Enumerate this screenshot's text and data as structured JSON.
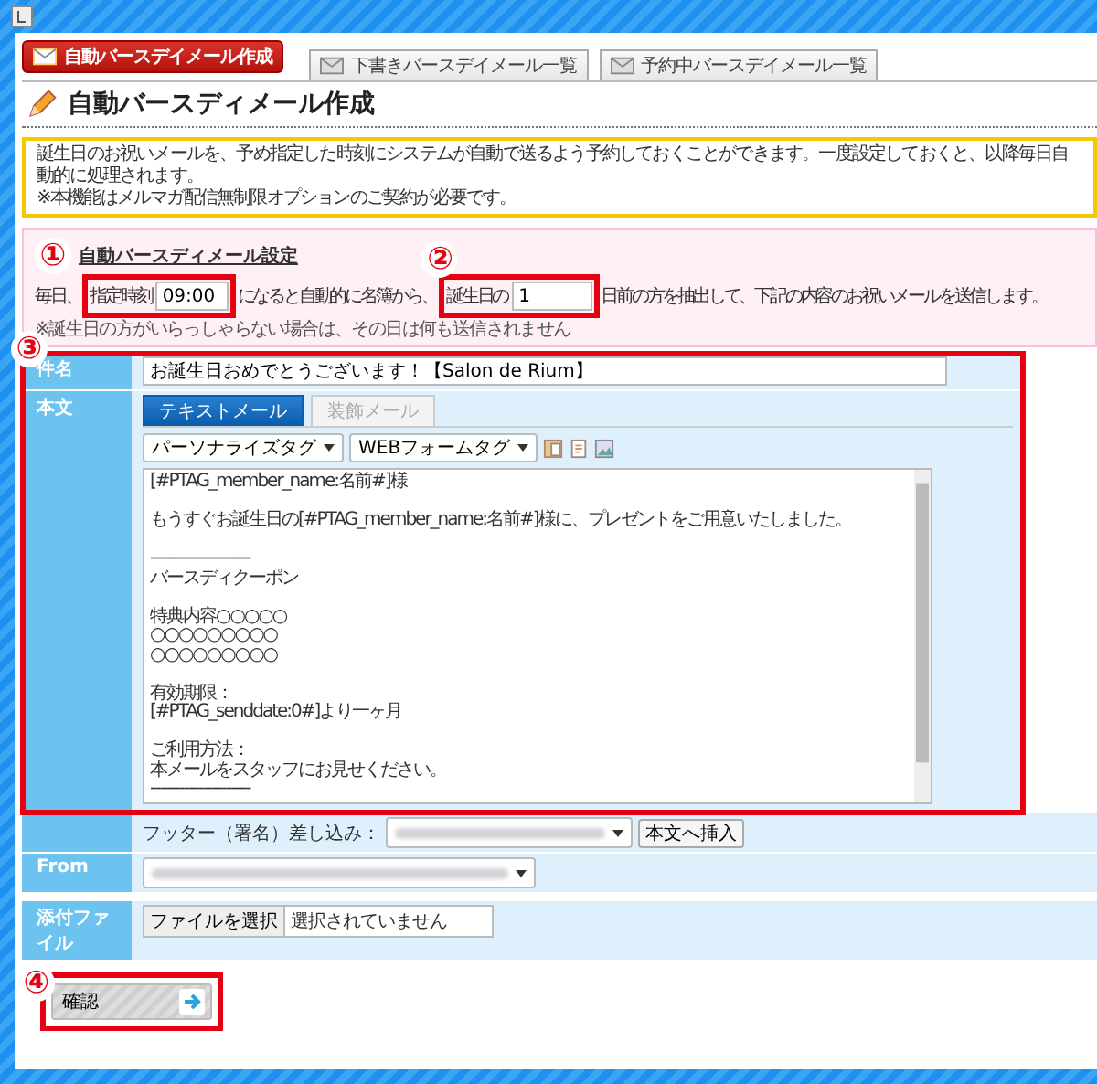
{
  "tabs": [
    {
      "label": "自動バースデイメール作成",
      "selected": true
    },
    {
      "label": "下書きバースデイメール一覧",
      "selected": false
    },
    {
      "label": "予約中バースデイメール一覧",
      "selected": false
    }
  ],
  "page_title": "自動バースディメール作成",
  "notice": [
    "誕生日のお祝いメールを、予め指定した時刻にシステムが自動で送るよう予約しておくことができます。一度設定しておくと、以降毎日自動的に処理されます。",
    "※本機能はメルマガ配信無制限オプションのご契約が必要です。"
  ],
  "settings": {
    "heading": "自動バースディメール設定",
    "text_1": "毎日、",
    "time_label": "指定時刻",
    "time_value": "09:00",
    "text_2": "になると自動的に名簿から、",
    "days_label": "誕生日の",
    "days_value": "1",
    "text_3": "日前の方を抽出して、下記の内容のお祝いメールを送信します。",
    "note": "※誕生日の方がいらっしゃらない場合は、その日は何も送信されません"
  },
  "form": {
    "subject_label": "件名",
    "subject_value": "お誕生日おめでとうございます！【Salon de Rium】",
    "body_label": "本文",
    "editor_tabs": [
      {
        "label": "テキストメール",
        "selected": true
      },
      {
        "label": "装飾メール",
        "selected": false
      }
    ],
    "tag_dropdowns": [
      "パーソナライズタグ",
      "WEBフォームタグ"
    ],
    "body_paragraphs": [
      [
        "[#PTAG_member_name:名前#]様"
      ],
      [
        "もうすぐお誕生日の[#PTAG_member_name:名前#]様に、プレゼントをご用意いたしました。"
      ],
      [
        "---------------------",
        "バースディクーポン"
      ],
      [
        "特典内容○○○○○",
        "○○○○○○○○○",
        "○○○○○○○○○"
      ],
      [
        "有効期限：",
        "[#PTAG_senddate:0#]より一ヶ月"
      ],
      [
        "ご利用方法：",
        "本メールをスタッフにお見せください。",
        "---------------------"
      ]
    ],
    "footer_label": "フッター（署名）差し込み：",
    "footer_button": "本文へ挿入",
    "from_label": "From",
    "attach_label": "添付ファイル",
    "file_button": "ファイルを選択",
    "file_status": "選択されていません"
  },
  "confirm_button": "確認",
  "annotations": [
    "①",
    "②",
    "③",
    "④"
  ]
}
